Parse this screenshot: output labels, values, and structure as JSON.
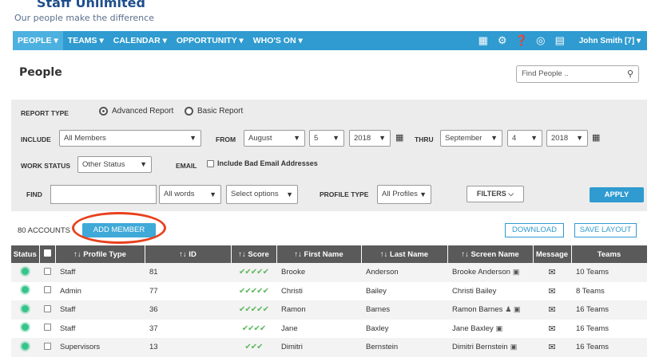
{
  "brand": {
    "name": "Staff Unlimited",
    "tagline": "Our people make the difference"
  },
  "nav": {
    "items": [
      {
        "label": "PEOPLE ▾",
        "key": "people"
      },
      {
        "label": "TEAMS ▾",
        "key": "teams"
      },
      {
        "label": "CALENDAR ▾",
        "key": "calendar"
      },
      {
        "label": "OPPORTUNITY ▾",
        "key": "opportunity"
      },
      {
        "label": "WHO'S ON ▾",
        "key": "whos-on"
      }
    ],
    "icons": [
      "document-icon",
      "gear-icon",
      "help-icon",
      "globe-icon",
      "folder-icon"
    ],
    "user": "John Smith [7] ▾"
  },
  "page": {
    "title": "People",
    "search_placeholder": "Find People .."
  },
  "filters": {
    "report_type_label": "REPORT TYPE",
    "report_advanced": "Advanced Report",
    "report_basic": "Basic Report",
    "include_label": "INCLUDE",
    "include_value": "All Members",
    "from_label": "FROM",
    "from_month": "August",
    "from_day": "5",
    "from_year": "2018",
    "thru_label": "THRU",
    "thru_month": "September",
    "thru_day": "4",
    "thru_year": "2018",
    "work_status_label": "WORK STATUS",
    "work_status_value": "Other Status",
    "email_label": "EMAIL",
    "email_checkbox": "Include Bad Email Addresses",
    "find_label": "FIND",
    "find_mode": "All words",
    "select_options": "Select options",
    "profile_type_label": "PROFILE TYPE",
    "profile_type_value": "All Profiles",
    "filters_button": "FILTERS",
    "apply_button": "APPLY"
  },
  "toolbar": {
    "accounts": "80 ACCOUNTS",
    "add_member": "ADD MEMBER",
    "download": "DOWNLOAD",
    "save_layout": "SAVE LAYOUT"
  },
  "table": {
    "columns": [
      "Status",
      "",
      "↑↓ Profile Type",
      "↑↓ ID",
      "↑↓ Score",
      "↑↓ First Name",
      "↑↓ Last Name",
      "↑↓ Screen Name",
      "Message",
      "Teams"
    ],
    "rows": [
      {
        "profile_type": "Staff",
        "id": "81",
        "score": "✔✔✔✔",
        "score_half": "✔",
        "first": "Brooke",
        "last": "Anderson",
        "screen": "Brooke Anderson",
        "screen_icons": "▣",
        "teams": "10 Teams"
      },
      {
        "profile_type": "Admin",
        "id": "77",
        "score": "✔✔✔✔✔",
        "score_half": "",
        "first": "Christi",
        "last": "Bailey",
        "screen": "Christi Bailey",
        "screen_icons": "",
        "teams": "8 Teams"
      },
      {
        "profile_type": "Staff",
        "id": "36",
        "score": "✔✔✔✔✔",
        "score_half": "",
        "first": "Ramon",
        "last": "Barnes",
        "screen": "Ramon Barnes",
        "screen_icons": "♟ ▣",
        "teams": "16 Teams"
      },
      {
        "profile_type": "Staff",
        "id": "37",
        "score": "✔✔✔✔",
        "score_half": "",
        "first": "Jane",
        "last": "Baxley",
        "screen": "Jane Baxley",
        "screen_icons": "▣",
        "teams": "16 Teams"
      },
      {
        "profile_type": "Supervisors",
        "id": "13",
        "score": "✔✔✔",
        "score_half": "",
        "first": "Dimitri",
        "last": "Bernstein",
        "screen": "Dimitri Bernstein",
        "screen_icons": "▣",
        "teams": "16 Teams"
      }
    ]
  },
  "colors": {
    "nav": "#2f9bd0",
    "status_active": "#35c48a",
    "highlight": "#e8401c"
  }
}
